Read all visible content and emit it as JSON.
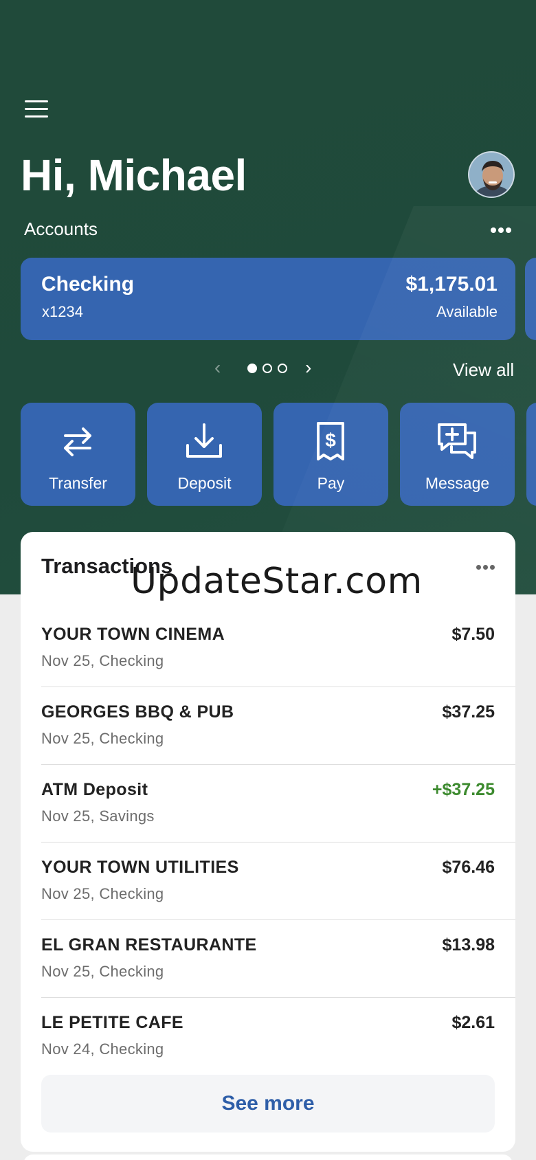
{
  "header": {
    "greeting": "Hi, Michael",
    "accounts_label": "Accounts",
    "view_all": "View all"
  },
  "account": {
    "name": "Checking",
    "number": "x1234",
    "balance": "$1,175.01",
    "balance_label": "Available"
  },
  "pager": {
    "total": 3,
    "active": 1
  },
  "actions": [
    {
      "label": "Transfer",
      "icon": "transfer-icon"
    },
    {
      "label": "Deposit",
      "icon": "deposit-icon"
    },
    {
      "label": "Pay",
      "icon": "pay-icon"
    },
    {
      "label": "Message",
      "icon": "message-icon"
    }
  ],
  "transactions": {
    "title": "Transactions",
    "items": [
      {
        "name": "YOUR TOWN CINEMA",
        "sub": "Nov 25, Checking",
        "amount": "$7.50"
      },
      {
        "name": "GEORGES BBQ & PUB",
        "sub": "Nov 25, Checking",
        "amount": "$37.25"
      },
      {
        "name": "ATM Deposit",
        "sub": "Nov 25, Savings",
        "amount": "+$37.25"
      },
      {
        "name": "YOUR TOWN UTILITIES",
        "sub": "Nov 25, Checking",
        "amount": "$76.46"
      },
      {
        "name": "EL GRAN RESTAURANTE",
        "sub": "Nov 25, Checking",
        "amount": "$13.98"
      },
      {
        "name": "LE PETITE CAFE",
        "sub": "Nov 24, Checking",
        "amount": "$2.61"
      }
    ],
    "see_more": "See more"
  },
  "watermark": "UpdateStar.com",
  "colors": {
    "hero_bg": "#204a3a",
    "accent_blue": "#3565b0",
    "credit_green": "#3c8a2e",
    "link_blue": "#2e5ea8"
  }
}
